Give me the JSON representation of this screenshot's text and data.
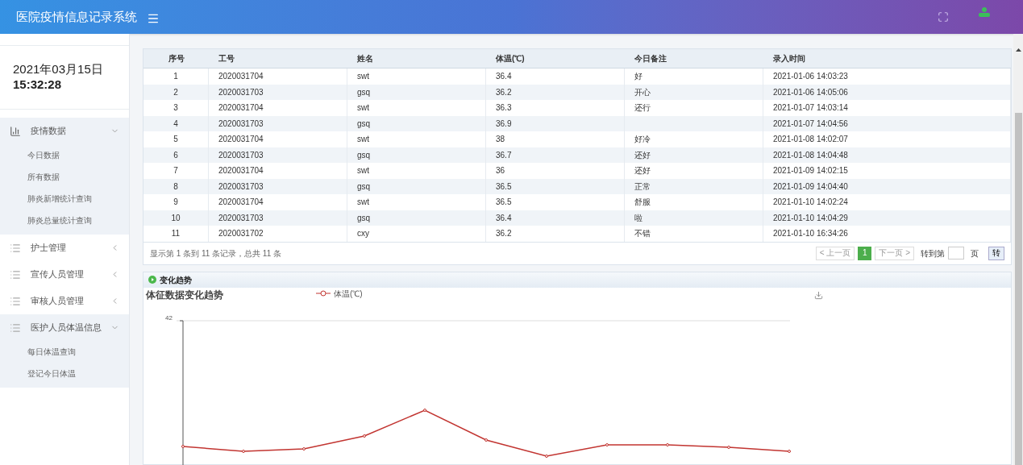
{
  "header": {
    "title": "医院疫情信息记录系统"
  },
  "clock": {
    "date": "2021年03月15日",
    "time": "15:32:28"
  },
  "sidebar": {
    "groups": [
      {
        "label": "疫情数据",
        "kind": "chart",
        "expanded": true,
        "children": [
          "今日数据",
          "所有数据",
          "肺炎新增统计查询",
          "肺炎总量统计查询"
        ]
      },
      {
        "label": "护士管理",
        "kind": "list",
        "expanded": false
      },
      {
        "label": "宣传人员管理",
        "kind": "list",
        "expanded": false
      },
      {
        "label": "审核人员管理",
        "kind": "list",
        "expanded": false
      },
      {
        "label": "医护人员体温信息",
        "kind": "list",
        "expanded": true,
        "children": [
          "每日体温查询",
          "登记今日体温"
        ]
      }
    ]
  },
  "table": {
    "columns": [
      "序号",
      "工号",
      "姓名",
      "体温(℃)",
      "今日备注",
      "录入时间"
    ],
    "rows": [
      [
        "1",
        "2020031704",
        "swt",
        "36.4",
        "好",
        "2021-01-06 14:03:23"
      ],
      [
        "2",
        "2020031703",
        "gsq",
        "36.2",
        "开心",
        "2021-01-06 14:05:06"
      ],
      [
        "3",
        "2020031704",
        "swt",
        "36.3",
        "还行",
        "2021-01-07 14:03:14"
      ],
      [
        "4",
        "2020031703",
        "gsq",
        "36.9",
        "",
        "2021-01-07 14:04:56"
      ],
      [
        "5",
        "2020031704",
        "swt",
        "38",
        "好冷",
        "2021-01-08 14:02:07"
      ],
      [
        "6",
        "2020031703",
        "gsq",
        "36.7",
        "还好",
        "2021-01-08 14:04:48"
      ],
      [
        "7",
        "2020031704",
        "swt",
        "36",
        "还好",
        "2021-01-09 14:02:15"
      ],
      [
        "8",
        "2020031703",
        "gsq",
        "36.5",
        "正常",
        "2021-01-09 14:04:40"
      ],
      [
        "9",
        "2020031704",
        "swt",
        "36.5",
        "舒服",
        "2021-01-10 14:02:24"
      ],
      [
        "10",
        "2020031703",
        "gsq",
        "36.4",
        "啦",
        "2021-01-10 14:04:29"
      ],
      [
        "11",
        "2020031702",
        "cxy",
        "36.2",
        "不错",
        "2021-01-10 16:34:26"
      ]
    ],
    "summary": "显示第 1 条到 11 条记录，总共 11 条",
    "pagination": {
      "prev": "< 上一页",
      "pages": [
        {
          "label": "1",
          "selected": true
        }
      ],
      "next": "下一页 >",
      "goto_label": "转到第",
      "page_unit": "页",
      "go": "转"
    }
  },
  "trend": {
    "panel_title": "变化趋势",
    "chart_title": "体征数据变化趋势",
    "legend": "体温(℃)",
    "y_tick": "42"
  }
}
